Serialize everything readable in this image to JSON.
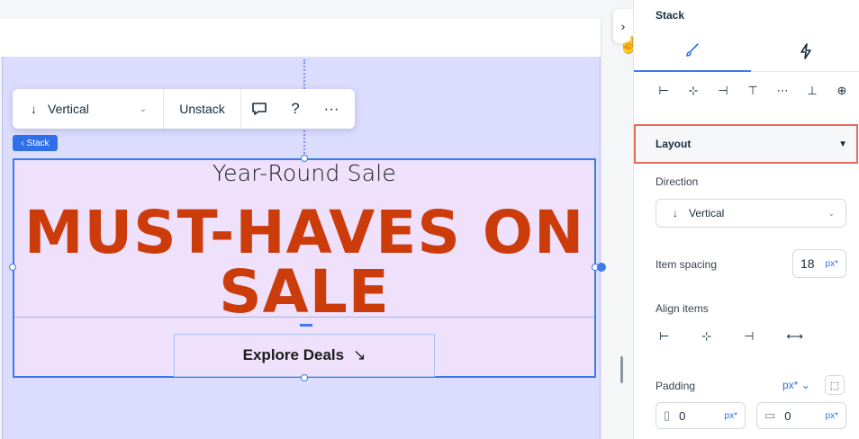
{
  "canvas": {
    "toolbar": {
      "direction_label": "Vertical",
      "unstack_label": "Unstack",
      "icons": [
        "arrow-down-icon",
        "chevron-down-icon",
        "comment-icon",
        "help-icon",
        "more-icon"
      ],
      "help_glyph": "?",
      "more_glyph": "···"
    },
    "stack_tag": "‹ Stack",
    "content": {
      "subtitle": "Year-Round Sale",
      "headline_line1": "MUST-HAVES ON",
      "headline_line2": "SALE",
      "button_label": "Explore Deals",
      "button_arrow": "↘"
    },
    "colors": {
      "headline": "#cc3c0b",
      "selection": "#3a7bef",
      "section_bg": "#dcdcff",
      "stack_bg": "#efe0fb"
    }
  },
  "panel": {
    "title": "Stack",
    "tabs": [
      {
        "icon": "brush-icon",
        "active": true
      },
      {
        "icon": "lightning-icon",
        "active": false
      }
    ],
    "layout_header": "Layout",
    "direction": {
      "label": "Direction",
      "value": "Vertical"
    },
    "item_spacing": {
      "label": "Item spacing",
      "value": "18",
      "unit": "px*"
    },
    "align_items": {
      "label": "Align items"
    },
    "padding": {
      "label": "Padding",
      "unit": "px*",
      "left": {
        "value": "0",
        "unit": "px*"
      },
      "top": {
        "value": "0",
        "unit": "px*"
      }
    }
  }
}
